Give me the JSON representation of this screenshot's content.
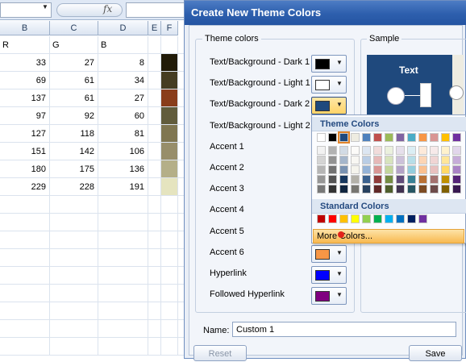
{
  "spreadsheet": {
    "fx_symbol": "fx",
    "columns": [
      "B",
      "C",
      "D",
      "E",
      "F"
    ],
    "header_row": [
      "R",
      "G",
      "B"
    ],
    "rows": [
      [
        33,
        27,
        8
      ],
      [
        69,
        61,
        34
      ],
      [
        137,
        61,
        27
      ],
      [
        97,
        92,
        60
      ],
      [
        127,
        118,
        81
      ],
      [
        151,
        142,
        106
      ],
      [
        180,
        175,
        136
      ],
      [
        229,
        228,
        191
      ]
    ],
    "f_colors": [
      "#211b08",
      "#453d22",
      "#893d1b",
      "#615c3c",
      "#7f7651",
      "#978e6a",
      "#b4af88",
      "#e5e4bf"
    ]
  },
  "dialog": {
    "title": "Create New Theme Colors",
    "theme_colors_label": "Theme colors",
    "sample_label": "Sample",
    "sample_text": "Text",
    "items": [
      {
        "label": "Text/Background - Dark 1",
        "color": "#000000"
      },
      {
        "label": "Text/Background - Light 1",
        "color": "#ffffff"
      },
      {
        "label": "Text/Background - Dark 2",
        "color": "#1f497d"
      },
      {
        "label": "Text/Background - Light 2",
        "color": "#eeece1"
      },
      {
        "label": "Accent 1",
        "color": "#4f81bd"
      },
      {
        "label": "Accent 2",
        "color": "#c0504d"
      },
      {
        "label": "Accent 3",
        "color": "#9bbb59"
      },
      {
        "label": "Accent 4",
        "color": "#8064a2"
      },
      {
        "label": "Accent 5",
        "color": "#4bacc6"
      },
      {
        "label": "Accent 6",
        "color": "#f79646"
      },
      {
        "label": "Hyperlink",
        "color": "#0000ff"
      },
      {
        "label": "Followed Hyperlink",
        "color": "#800080"
      }
    ],
    "name_label": "Name:",
    "name_value": "Custom 1",
    "reset_label": "Reset",
    "save_label": "Save"
  },
  "color_popup": {
    "theme_header": "Theme Colors",
    "standard_header": "Standard Colors",
    "more_label": "More Colors...",
    "theme_top": [
      "#ffffff",
      "#000000",
      "#1f497d",
      "#eeece1",
      "#4f81bd",
      "#c0504d",
      "#9bbb59",
      "#8064a2",
      "#4bacc6",
      "#f79646",
      "#d99694",
      "#ffc000",
      "#7030a0"
    ],
    "standard": [
      "#c00000",
      "#ff0000",
      "#ffc000",
      "#ffff00",
      "#92d050",
      "#00b050",
      "#00b0f0",
      "#0070c0",
      "#002060",
      "#7030a0"
    ]
  }
}
